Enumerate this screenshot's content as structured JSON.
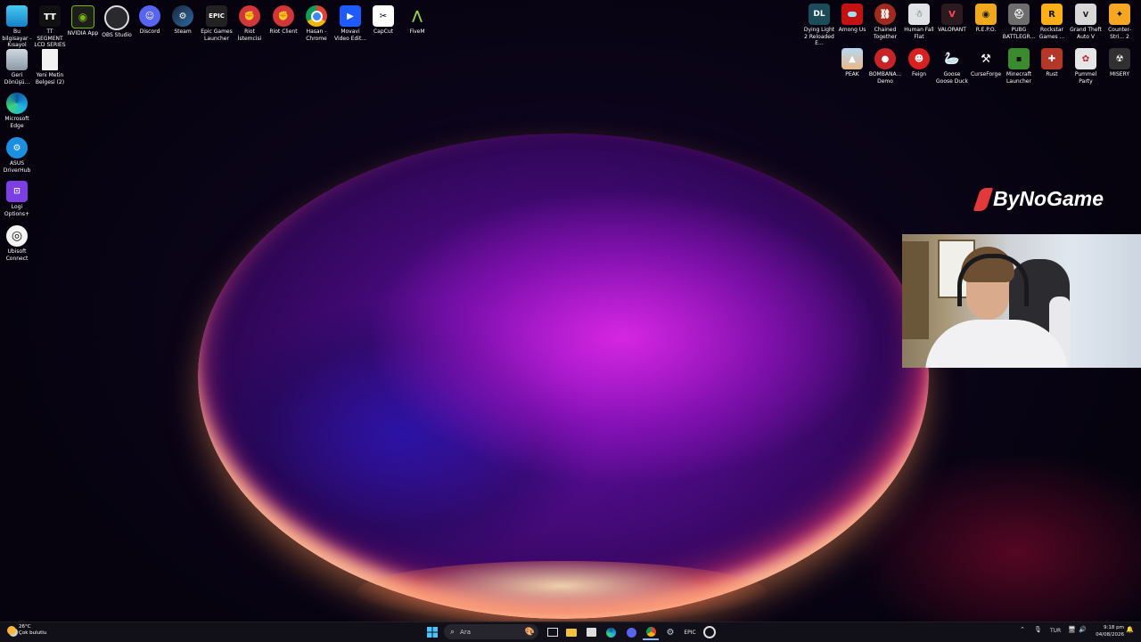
{
  "desktop": {
    "left_icons": [
      {
        "label": "Bu bilgisayar - Kısayol",
        "icon": "computer-icon"
      },
      {
        "label": "TT SEGMENT LCD SERIES",
        "icon": "tt-segment-icon"
      },
      {
        "label": "NVIDIA App",
        "icon": "nvidia-icon"
      },
      {
        "label": "OBS Studio",
        "icon": "obs-icon"
      },
      {
        "label": "Discord",
        "icon": "discord-icon"
      },
      {
        "label": "Steam",
        "icon": "steam-icon"
      },
      {
        "label": "Epic Games Launcher",
        "icon": "epic-games-icon"
      },
      {
        "label": "Riot İstemcisi",
        "icon": "riot-icon"
      },
      {
        "label": "Riot Client",
        "icon": "riot-icon"
      },
      {
        "label": "Hasan - Chrome",
        "icon": "chrome-icon"
      },
      {
        "label": "Movavi Video Edit...",
        "icon": "movavi-icon"
      },
      {
        "label": "CapCut",
        "icon": "capcut-icon"
      },
      {
        "label": "FiveM",
        "icon": "fivem-icon"
      },
      {
        "label": "Geri Dönüşü...",
        "icon": "recycle-bin-icon"
      },
      {
        "label": "Yeni Metin Belgesi (2)",
        "icon": "text-document-icon"
      },
      {
        "label": "Microsoft Edge",
        "icon": "edge-icon"
      },
      {
        "label": "ASUS DriverHub",
        "icon": "asus-icon"
      },
      {
        "label": "Logi Options+",
        "icon": "logi-icon"
      },
      {
        "label": "Ubisoft Connect",
        "icon": "ubisoft-icon"
      }
    ],
    "right_icons_row1": [
      {
        "label": "Dying Light 2 Reloaded E...",
        "icon": "dying-light-icon"
      },
      {
        "label": "Among Us",
        "icon": "among-us-icon"
      },
      {
        "label": "Chained Together",
        "icon": "chained-together-icon"
      },
      {
        "label": "Human Fall Flat",
        "icon": "human-fall-flat-icon"
      },
      {
        "label": "VALORANT",
        "icon": "valorant-icon"
      },
      {
        "label": "R.E.P.O.",
        "icon": "repo-icon"
      },
      {
        "label": "PUBG BATTLEGR...",
        "icon": "pubg-icon"
      },
      {
        "label": "Rockstar Games ...",
        "icon": "rockstar-icon"
      },
      {
        "label": "Grand Theft Auto V",
        "icon": "gta-icon"
      },
      {
        "label": "Counter-Stri... 2",
        "icon": "counter-strike-icon"
      }
    ],
    "right_icons_row2": [
      {
        "label": "PEAK",
        "icon": "peak-icon"
      },
      {
        "label": "BOMBANA... Demo",
        "icon": "bombana-icon"
      },
      {
        "label": "Feign",
        "icon": "feign-icon"
      },
      {
        "label": "Goose Goose Duck",
        "icon": "goose-icon"
      },
      {
        "label": "CurseForge",
        "icon": "curseforge-icon"
      },
      {
        "label": "Minecraft Launcher",
        "icon": "minecraft-icon"
      },
      {
        "label": "Rust",
        "icon": "rust-icon"
      },
      {
        "label": "Pummel Party",
        "icon": "pummel-party-icon"
      },
      {
        "label": "MISERY",
        "icon": "misery-icon"
      }
    ]
  },
  "overlay": {
    "brand_text": "ByNoGame"
  },
  "taskbar": {
    "weather_temp": "26°C",
    "weather_desc": "Çok bulutlu",
    "search_placeholder": "Ara",
    "language": "TUR",
    "time": "9:18 pm",
    "date": "04/08/2026"
  },
  "colors": {
    "accent_blue": "#2f7cf6",
    "brand_red": "#e23a3a"
  }
}
